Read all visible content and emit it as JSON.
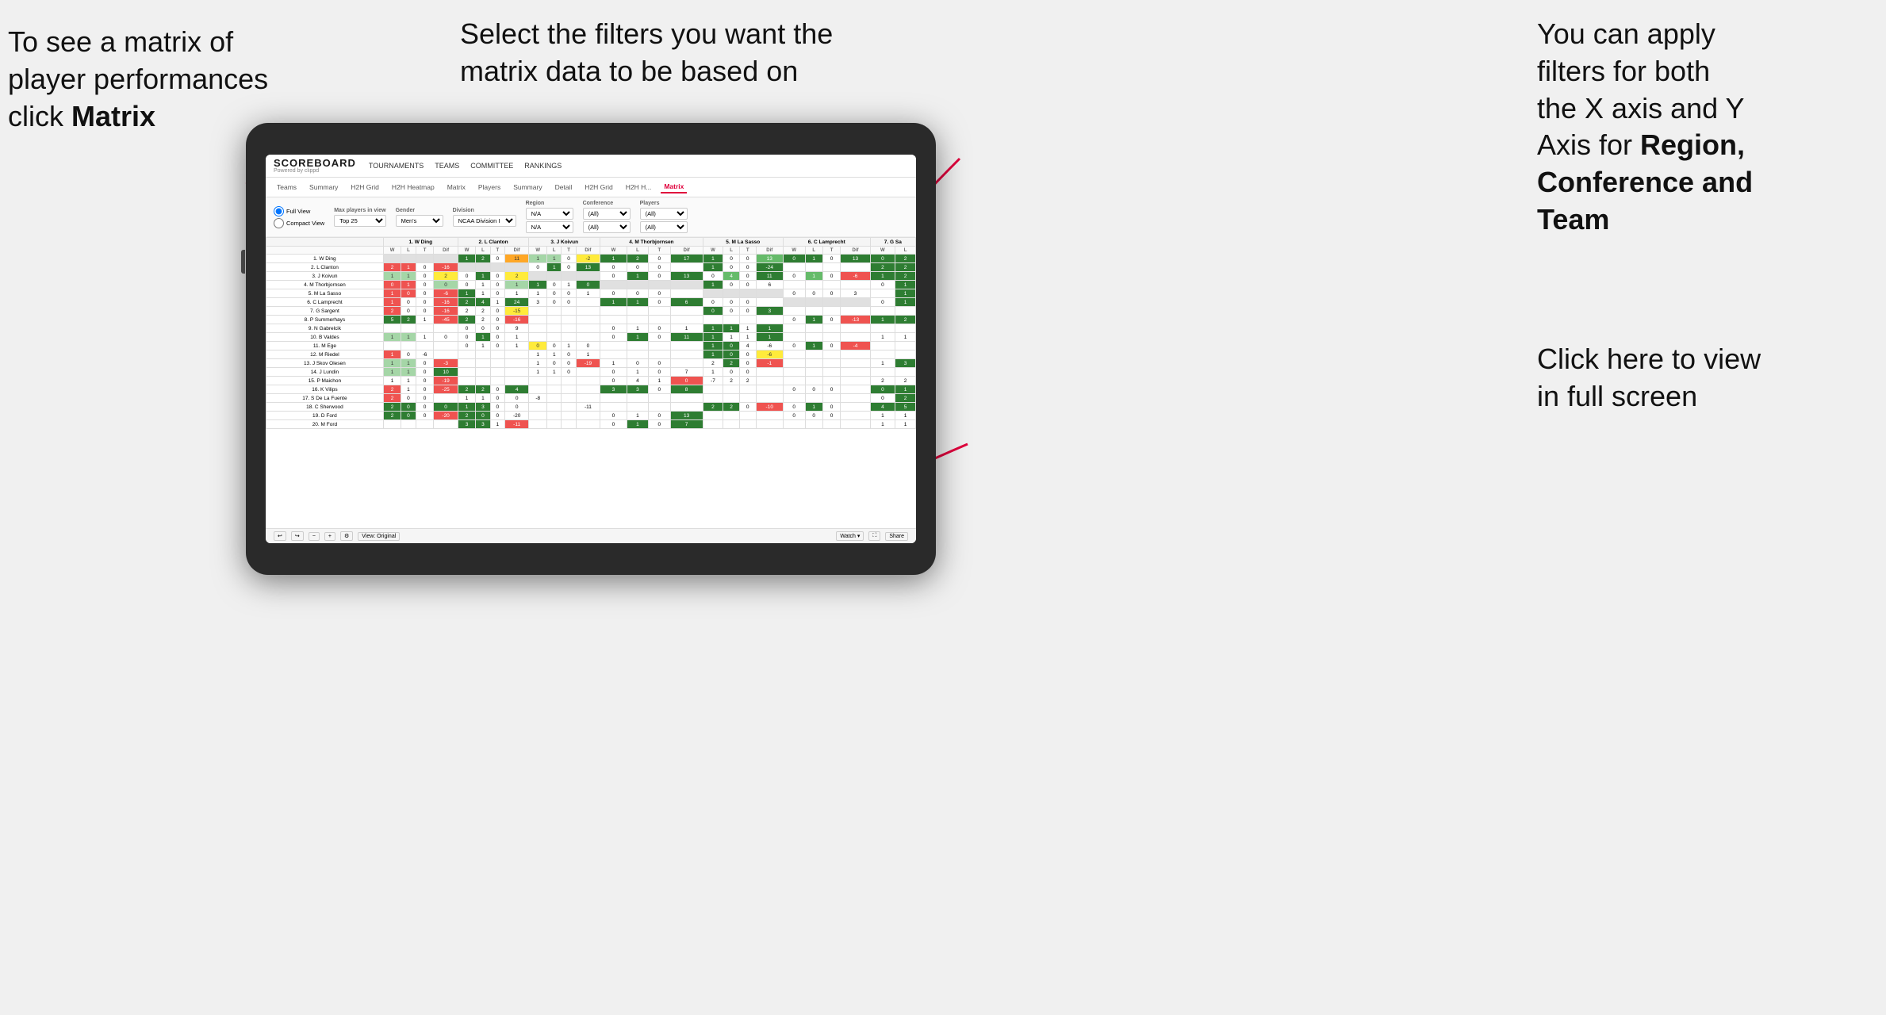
{
  "annotations": {
    "left": {
      "line1": "To see a matrix of",
      "line2": "player performances",
      "line3_plain": "click ",
      "line3_bold": "Matrix"
    },
    "center": {
      "text": "Select the filters you want the matrix data to be based on"
    },
    "right_top": {
      "line1": "You  can apply",
      "line2": "filters for both",
      "line3": "the X axis and Y",
      "line4_plain": "Axis for ",
      "line4_bold": "Region,",
      "line5_bold": "Conference and",
      "line6_bold": "Team"
    },
    "right_bottom": {
      "line1": "Click here to view",
      "line2": "in full screen"
    }
  },
  "app": {
    "logo": "SCOREBOARD",
    "logo_sub": "Powered by clippd",
    "nav": [
      "TOURNAMENTS",
      "TEAMS",
      "COMMITTEE",
      "RANKINGS"
    ],
    "sub_nav": [
      "Teams",
      "Summary",
      "H2H Grid",
      "H2H Heatmap",
      "Matrix",
      "Players",
      "Summary",
      "Detail",
      "H2H Grid",
      "H2H H...",
      "Matrix"
    ],
    "active_tab": "Matrix"
  },
  "filters": {
    "view_options": [
      "Full View",
      "Compact View"
    ],
    "max_players": {
      "label": "Max players in view",
      "value": "Top 25"
    },
    "gender": {
      "label": "Gender",
      "value": "Men's"
    },
    "division": {
      "label": "Division",
      "value": "NCAA Division I"
    },
    "region": {
      "label": "Region",
      "values": [
        "N/A",
        "N/A"
      ]
    },
    "conference": {
      "label": "Conference",
      "values": [
        "(All)",
        "(All)"
      ]
    },
    "players": {
      "label": "Players",
      "values": [
        "(All)",
        "(All)"
      ]
    }
  },
  "matrix": {
    "col_headers": [
      "1. W Ding",
      "2. L Clanton",
      "3. J Koivun",
      "4. M Thorbjornsen",
      "5. M La Sasso",
      "6. C Lamprecht",
      "7. G Sa"
    ],
    "sub_headers": [
      "W",
      "L",
      "T",
      "Dif"
    ],
    "rows": [
      {
        "label": "1. W Ding"
      },
      {
        "label": "2. L Clanton"
      },
      {
        "label": "3. J Koivun"
      },
      {
        "label": "4. M Thorbjornsen"
      },
      {
        "label": "5. M La Sasso"
      },
      {
        "label": "6. C Lamprecht"
      },
      {
        "label": "7. G Sargent"
      },
      {
        "label": "8. P Summerhays"
      },
      {
        "label": "9. N Gabrelcik"
      },
      {
        "label": "10. B Valdes"
      },
      {
        "label": "11. M Ege"
      },
      {
        "label": "12. M Riedel"
      },
      {
        "label": "13. J Skov Olesen"
      },
      {
        "label": "14. J Lundin"
      },
      {
        "label": "15. P Maichon"
      },
      {
        "label": "16. K Vilips"
      },
      {
        "label": "17. S De La Fuente"
      },
      {
        "label": "18. C Sherwood"
      },
      {
        "label": "19. D Ford"
      },
      {
        "label": "20. M Ford"
      }
    ]
  },
  "toolbar": {
    "view_label": "View: Original",
    "watch_label": "Watch ▾",
    "share_label": "Share"
  }
}
